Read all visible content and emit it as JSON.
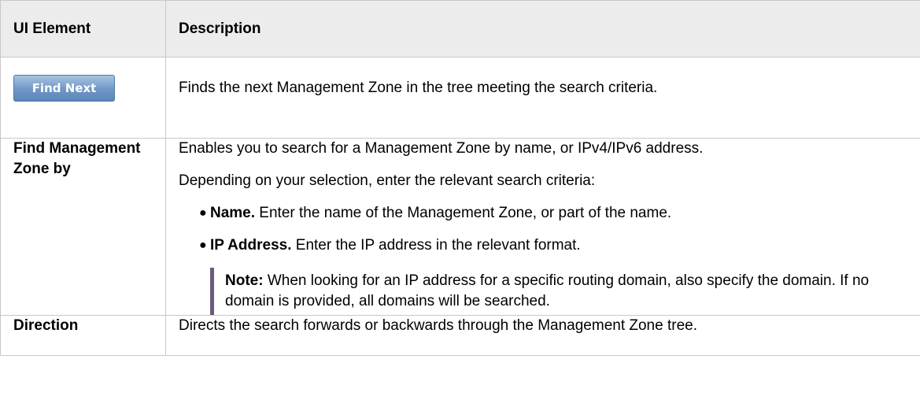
{
  "table": {
    "headers": {
      "element": "UI Element",
      "description": "Description"
    },
    "find_next": {
      "button_label": "Find Next",
      "description": "Finds the next Management Zone in the tree meeting the search criteria."
    },
    "find_by": {
      "label": "Find Management Zone by",
      "intro": "Enables you to search for a Management Zone by name, or IPv4/IPv6 address.",
      "criteria_intro": "Depending on your selection, enter the relevant search criteria:",
      "items": [
        {
          "term": "Name.",
          "text": " Enter the name of the Management Zone, or part of the name."
        },
        {
          "term": "IP Address.",
          "text": " Enter the IP address in the relevant format."
        }
      ],
      "note_label": "Note:",
      "note_text": "  When looking for an IP address for a specific routing domain, also specify the domain. If no domain is provided, all domains will be searched."
    },
    "direction": {
      "label": "Direction",
      "description": "Directs the search forwards or backwards through the Management Zone tree."
    }
  },
  "colors": {
    "header_bg": "#ececec",
    "border": "#c8c8c8",
    "note_bar": "#6f5a7a",
    "button_bg": "#6f96c6"
  }
}
